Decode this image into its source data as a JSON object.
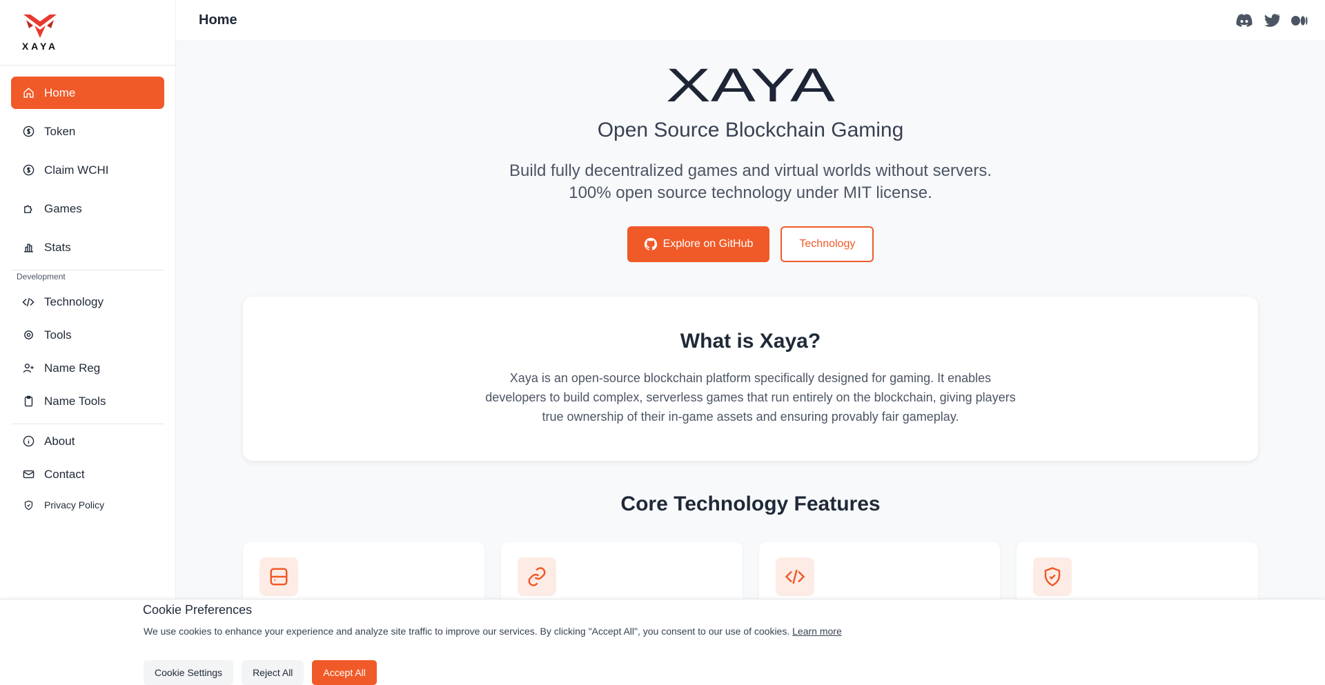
{
  "brand": {
    "logo_text": "XAYA",
    "hero_wordmark": "XAYA",
    "accent_color": "#f05a28"
  },
  "sidebar": {
    "items": [
      {
        "label": "Home",
        "icon": "home-icon",
        "active": true
      },
      {
        "label": "Token",
        "icon": "dollar-circle-icon"
      },
      {
        "label": "Claim WCHI",
        "icon": "dollar-circle-icon"
      },
      {
        "label": "Games",
        "icon": "puzzle-icon"
      },
      {
        "label": "Stats",
        "icon": "bar-chart-icon"
      }
    ],
    "section_label": "Development",
    "dev_items": [
      {
        "label": "Technology",
        "icon": "code-icon"
      },
      {
        "label": "Tools",
        "icon": "gear-icon"
      },
      {
        "label": "Name Reg",
        "icon": "user-plus-icon"
      },
      {
        "label": "Name Tools",
        "icon": "clipboard-icon"
      }
    ],
    "bottom_items": [
      {
        "label": "About",
        "icon": "info-icon"
      },
      {
        "label": "Contact",
        "icon": "mail-icon"
      },
      {
        "label": "Privacy Policy",
        "icon": "shield-icon"
      }
    ]
  },
  "header": {
    "title": "Home",
    "social": [
      "discord-icon",
      "twitter-icon",
      "medium-icon"
    ]
  },
  "hero": {
    "title": "Open Source Blockchain Gaming",
    "subtitle_line1": "Build fully decentralized games and virtual worlds without servers.",
    "subtitle_line2": "100% open source technology under MIT license.",
    "primary_button": "Explore on GitHub",
    "secondary_button": "Technology"
  },
  "about": {
    "heading": "What is Xaya?",
    "body": "Xaya is an open-source blockchain platform specifically designed for gaming. It enables developers to build complex, serverless games that run entirely on the blockchain, giving players true ownership of their in-game assets and ensuring provably fair gameplay."
  },
  "features": {
    "heading": "Core Technology Features",
    "cards": [
      {
        "icon": "server-icon"
      },
      {
        "icon": "link-icon"
      },
      {
        "icon": "code-icon"
      },
      {
        "icon": "shield-check-icon"
      }
    ]
  },
  "cookie": {
    "title": " Cookie Preferences",
    "text": "We use cookies to enhance your experience and analyze site traffic to improve our services. By clicking \"Accept All\", you consent to our use of cookies.",
    "learn_more": "Learn more",
    "settings_button": "Cookie Settings",
    "reject_button": "Reject All",
    "accept_button": "Accept All"
  }
}
